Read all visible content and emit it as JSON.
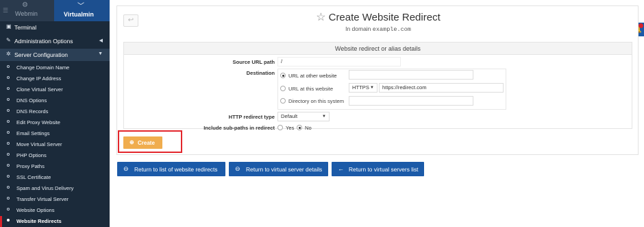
{
  "sidebar": {
    "tabs": [
      {
        "label": "Webmin",
        "icon": "gear-icon"
      },
      {
        "label": "Virtualmin",
        "icon": "chevron-down-icon"
      }
    ],
    "top_items": [
      {
        "label": "Terminal",
        "icon": "terminal-icon"
      },
      {
        "label": "Administration Options",
        "icon": "wrench-icon",
        "arrow": "◀"
      },
      {
        "label": "Server Configuration",
        "icon": "cogs-icon",
        "arrow": "▼"
      }
    ],
    "sub_items": [
      "Change Domain Name",
      "Change IP Address",
      "Clone Virtual Server",
      "DNS Options",
      "DNS Records",
      "Edit Proxy Website",
      "Email Settings",
      "Move Virtual Server",
      "PHP Options",
      "Proxy Paths",
      "SSL Certificate",
      "Spam and Virus Delivery",
      "Transfer Virtual Server",
      "Website Options",
      "Website Redirects"
    ],
    "selected_sub": "Website Redirects"
  },
  "header": {
    "title": "Create Website Redirect",
    "subtitle_prefix": "In domain",
    "domain": "example.com"
  },
  "form": {
    "heading": "Website redirect or alias details",
    "source_label": "Source URL path",
    "source_value": "/",
    "destination_label": "Destination",
    "dest_options": {
      "other": "URL at other website",
      "this": "URL at this website",
      "dir": "Directory on this system"
    },
    "dest_selected": "URL at other website",
    "protocol": "HTTPS",
    "this_site_url": "https://redirect.com",
    "redirect_type_label": "HTTP redirect type",
    "redirect_type_value": "Default",
    "subpaths_label": "Include sub-paths in redirect",
    "subpaths_yes": "Yes",
    "subpaths_no": "No",
    "subpaths_selected": "No"
  },
  "buttons": {
    "create": "Create",
    "back_redirects": "Return to list of website redirects",
    "back_server": "Return to virtual server details",
    "back_servers_list": "Return to virtual servers list"
  },
  "colors": {
    "sidebar_bg": "#1b2a3a",
    "accent_blue": "#1b5aa8",
    "create_orange": "#f0ad4e",
    "highlight_red": "#e3262c"
  }
}
